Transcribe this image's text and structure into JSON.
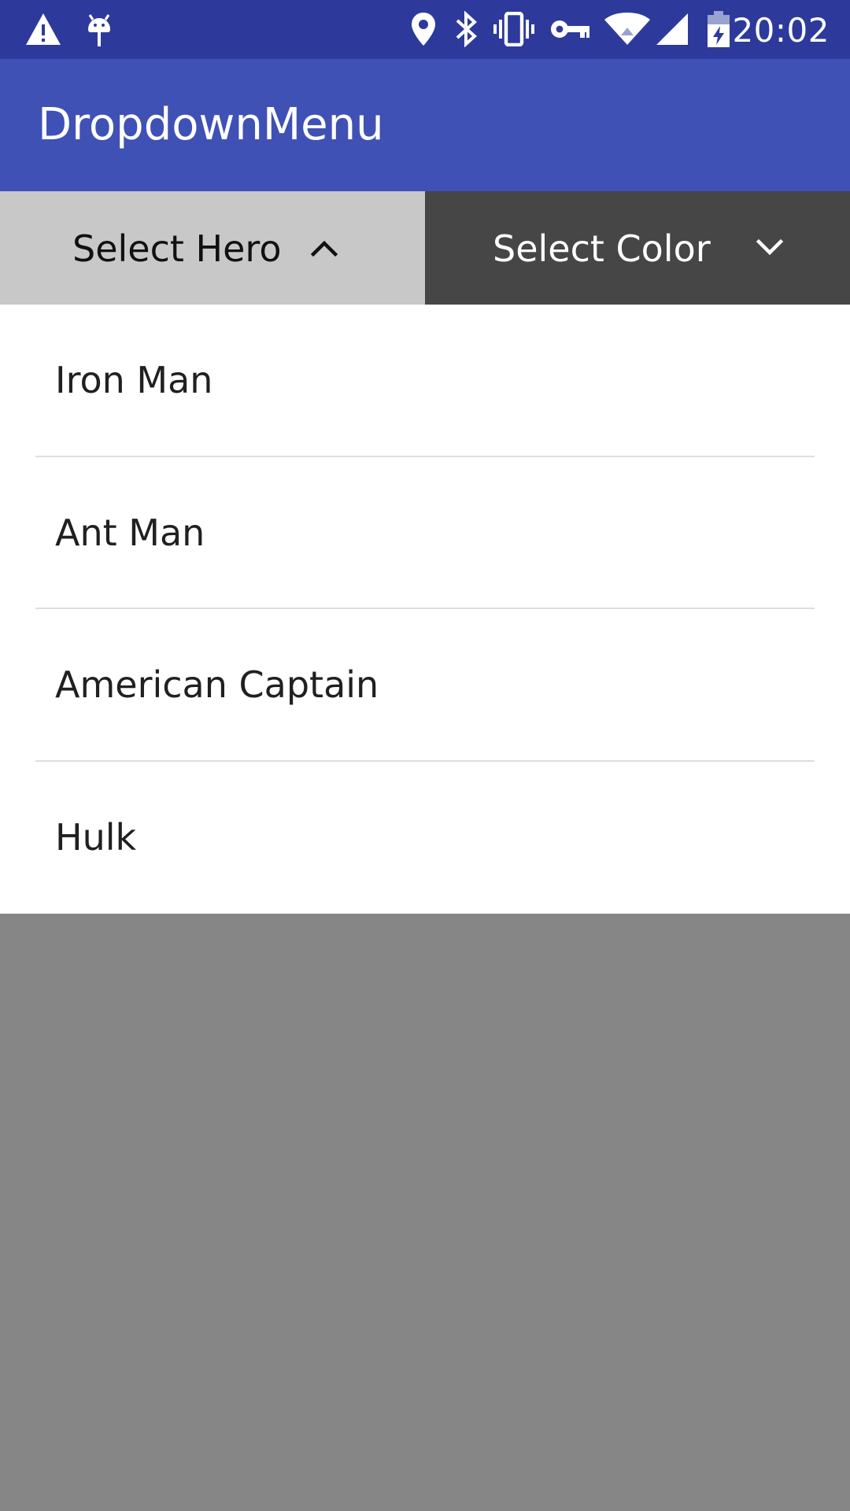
{
  "status_bar": {
    "time": "20:02",
    "icons": [
      "warning-icon",
      "android-debug-icon",
      "location-icon",
      "bluetooth-icon",
      "vibrate-icon",
      "vpn-key-icon",
      "wifi-icon",
      "cell-signal-icon",
      "battery-charging-icon"
    ],
    "background": "#2d3a9c"
  },
  "app_bar": {
    "title": "DropdownMenu",
    "background": "#3f51b5"
  },
  "tabs": [
    {
      "label": "Select Hero",
      "state": "expanded",
      "icon": "chevron-up-icon",
      "background": "#c8c8c8",
      "text_color": "#111111"
    },
    {
      "label": "Select Color",
      "state": "collapsed",
      "icon": "chevron-down-icon",
      "background": "#464646",
      "text_color": "#ffffff"
    }
  ],
  "dropdown": {
    "items": [
      {
        "label": "Iron Man"
      },
      {
        "label": "Ant Man"
      },
      {
        "label": "American Captain"
      },
      {
        "label": "Hulk"
      }
    ]
  },
  "colors": {
    "scrim": "#868686",
    "divider": "#dedede"
  }
}
